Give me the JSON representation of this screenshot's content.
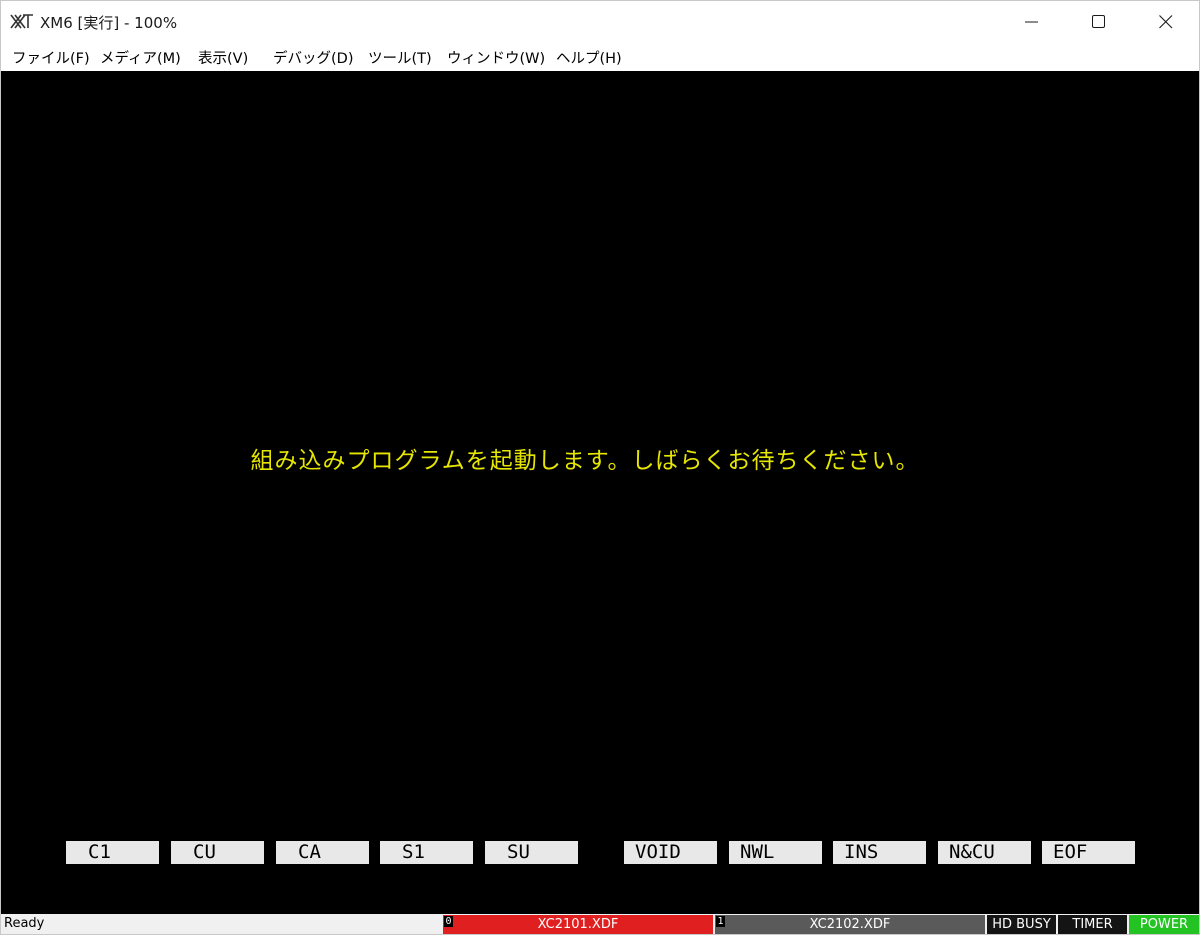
{
  "window": {
    "title": "XM6 [実行] - 100%",
    "icon": "x68000-logo-icon"
  },
  "menu": [
    {
      "label": "ファイル(F)"
    },
    {
      "label": "メディア(M)"
    },
    {
      "label": "表示(V)"
    },
    {
      "label": "デバッグ(D)"
    },
    {
      "label": "ツール(T)"
    },
    {
      "label": "ウィンドウ(W)"
    },
    {
      "label": "ヘルプ(H)"
    }
  ],
  "screen": {
    "message": "組み込みプログラムを起動します。しばらくお待ちください。",
    "message_color": "#e6e600",
    "function_keys": [
      "C1",
      "CU",
      "CA",
      "S1",
      "SU",
      "VOID",
      "NWL",
      "INS",
      "N&CU",
      "EOF"
    ]
  },
  "statusbar": {
    "ready": "Ready",
    "fdd0": {
      "num": "0",
      "file": "XC2101.XDF",
      "color": "#e02020"
    },
    "fdd1": {
      "num": "1",
      "file": "XC2102.XDF",
      "color": "#5a5a5a"
    },
    "hd_busy": "HD BUSY",
    "timer": "TIMER",
    "power": "POWER",
    "power_color": "#22c322"
  }
}
